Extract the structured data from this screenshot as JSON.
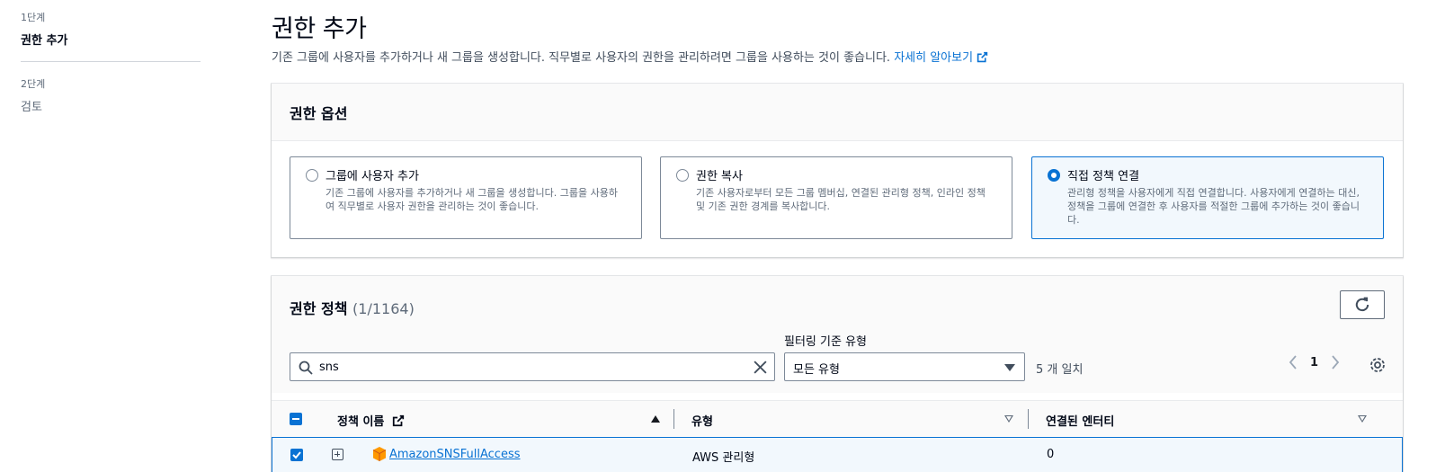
{
  "steps": [
    {
      "number": "1단계",
      "title": "권한 추가",
      "active": true
    },
    {
      "number": "2단계",
      "title": "검토",
      "active": false
    }
  ],
  "header": {
    "title": "권한 추가",
    "description": "기존 그룹에 사용자를 추가하거나 새 그룹을 생성합니다. 직무별로 사용자의 권한을 관리하려면 그룹을 사용하는 것이 좋습니다.",
    "learn_more": "자세히 알아보기"
  },
  "permission_options": {
    "title": "권한 옵션",
    "options": [
      {
        "title": "그룹에 사용자 추가",
        "desc_line1": "기존 그룹에 사용자를 추가하거나 새 그룹을 생성합니다. 그룹을 사용하",
        "desc_line2": "여 직무별로 사용자 권한을 관리하는 것이 좋습니다.",
        "desc_line3": "",
        "selected": false
      },
      {
        "title": "권한 복사",
        "desc_line1": "기존 사용자로부터 모든 그룹 멤버십, 연결된 관리형 정책, 인라인 정책",
        "desc_line2": "및 기존 권한 경계를 복사합니다.",
        "desc_line3": "",
        "selected": false
      },
      {
        "title": "직접 정책 연결",
        "desc_line1": "관리형 정책을 사용자에게 직접 연결합니다. 사용자에게 연결하는 대신,",
        "desc_line2": "정책을 그룹에 연결한 후 사용자를 적절한 그룹에 추가하는 것이 좋습니",
        "desc_line3": "다.",
        "selected": true
      }
    ]
  },
  "policies": {
    "title": "권한 정책",
    "count": "(1/1164)",
    "filter_label": "필터링 기준 유형",
    "search_value": "sns",
    "type_select": "모든 유형",
    "matches": "5 개 일치",
    "page": "1",
    "columns": {
      "name": "정책 이름",
      "type": "유형",
      "entities": "연결된 엔터티"
    },
    "rows": [
      {
        "name": "AmazonSNSFullAccess",
        "type": "AWS 관리형",
        "entities": "0",
        "checked": true
      }
    ]
  },
  "colors": {
    "accent": "#0972d3",
    "aws_orange": "#ff9900"
  }
}
